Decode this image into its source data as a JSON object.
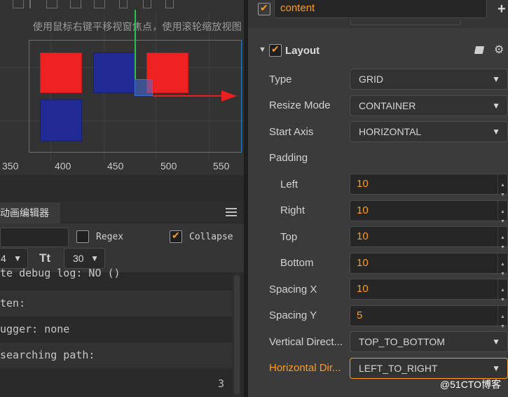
{
  "scene": {
    "hint": "使用鼠标右键平移视窗焦点，使用滚轮缩放视图",
    "ruler_ticks": [
      "350",
      "400",
      "450",
      "500",
      "550"
    ]
  },
  "anim": {
    "tab_label": "动画编辑器",
    "regex_label": "Regex",
    "regex_checked": false,
    "collapse_label": "Collapse",
    "collapse_checked": true,
    "font_size_value": "4",
    "tt_icon": "Tt",
    "line_count_value": "30",
    "logs": [
      "te debug log: NO ()",
      "ten:",
      "ugger: none",
      " searching path:"
    ],
    "log_count": "3"
  },
  "inspector": {
    "content_value": "content",
    "content_checked": true,
    "layout_title": "Layout",
    "layout_checked": true,
    "props": {
      "type_label": "Type",
      "type_value": "GRID",
      "resize_label": "Resize Mode",
      "resize_value": "CONTAINER",
      "start_axis_label": "Start Axis",
      "start_axis_value": "HORIZONTAL",
      "padding_label": "Padding",
      "left_label": "Left",
      "left_value": "10",
      "right_label": "Right",
      "right_value": "10",
      "top_label": "Top",
      "top_value": "10",
      "bottom_label": "Bottom",
      "bottom_value": "10",
      "spacing_x_label": "Spacing X",
      "spacing_x_value": "10",
      "spacing_y_label": "Spacing Y",
      "spacing_y_value": "5",
      "vdir_label": "Vertical Direct...",
      "vdir_value": "TOP_TO_BOTTOM",
      "hdir_label": "Horizontal Dir...",
      "hdir_value": "LEFT_TO_RIGHT"
    }
  },
  "watermark": "@51CTO博客",
  "colors": {
    "accent": "#ff9c1f",
    "frame": "#2f7fc8",
    "red_block": "#ee2222",
    "blue_block": "#222a96"
  }
}
